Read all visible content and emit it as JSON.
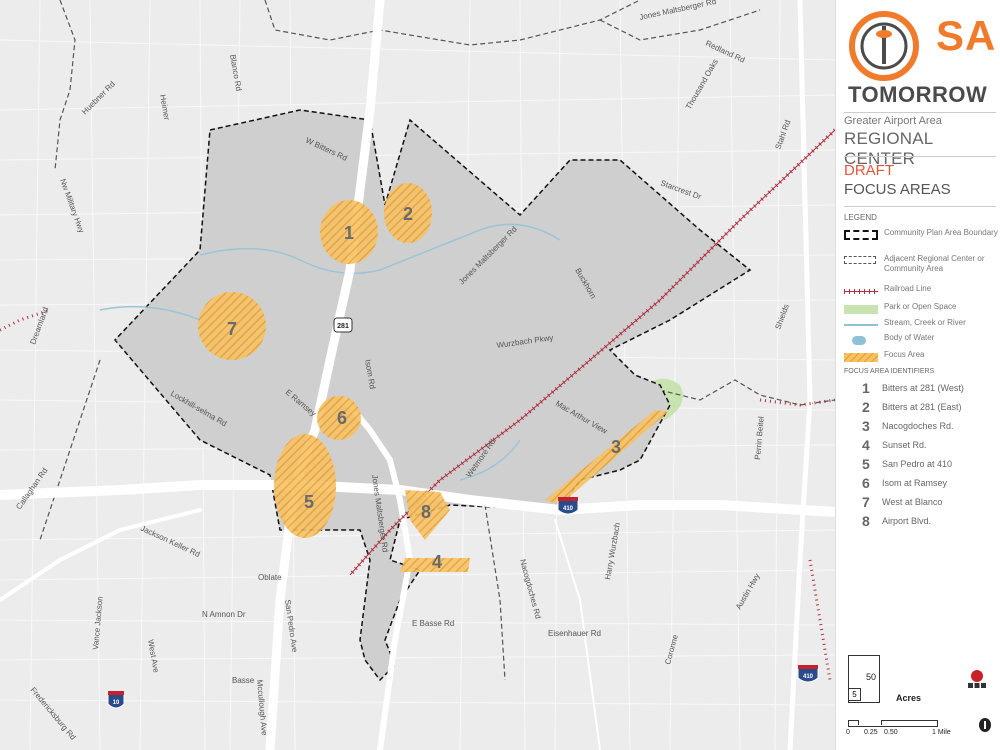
{
  "map": {
    "roads": {
      "jones_maltsberger_top": "Jones Maltsberger Rd",
      "redland": "Redland Rd",
      "blanco": "Blanco Rd",
      "hubner": "Huebner Rd",
      "nw_military": "Nw Military Hwy",
      "bitters": "W Bitters Rd",
      "jones_maltsberger_mid": "Jones Maltsberger Rd",
      "buckhorn": "Buckhorn",
      "wurzbach": "Wurzbach Pkwy",
      "lockhill": "Lockhill-selma Rd",
      "e_ramsey": "E Ramsey",
      "isom": "Isom Rd",
      "mac_arthur": "Mac Arthur View",
      "wetmore": "Wetmore Rd",
      "jones_maltsberger_low": "Jones Maltsberger Rd",
      "nacogdoches": "Nacogdoches Rd",
      "harry_wurzbach": "Harry Wurzbach",
      "e_basse": "E Basse Rd",
      "eisenhauer": "Eisenhauer Rd",
      "n_amnon": "N Amnon Dr",
      "oblate": "Oblate",
      "basse": "Basse",
      "san_pedro": "San Pedro Ave",
      "west_ave": "West Ave",
      "vance_jackson": "Vance Jackson",
      "mccullough": "Mccullough Ave",
      "fredericksburg": "Fredericksburg Rd",
      "callaghan": "Callaghan Rd",
      "jackson_keller": "Jackson Keller Rd",
      "dreamland": "Dreamland",
      "austin_hwy": "Austin Hwy",
      "coronne": "Coronne",
      "perrin": "Perrin Beitel",
      "starcrest": "Starcrest Dr",
      "stahl": "Stahl Rd",
      "thousand_oaks": "Thousand Oaks",
      "shields": "Shields",
      "heimer": "Heimer"
    },
    "shields": {
      "us281": "281",
      "i410": "410",
      "i410_east": "410",
      "i10": "10"
    },
    "focus_labels": [
      "1",
      "2",
      "3",
      "4",
      "5",
      "6",
      "7",
      "8"
    ]
  },
  "panel": {
    "logo": {
      "sa": "SA",
      "tomorrow": "TOMORROW"
    },
    "subtitle_small": "Greater Airport Area",
    "subtitle_large": "REGIONAL CENTER",
    "draft": "DRAFT",
    "focus_title": "FOCUS AREAS",
    "legend_title": "LEGEND",
    "legend": [
      {
        "label": "Community Plan Area Boundary"
      },
      {
        "label": "Adjacent Regional Center or Community Area"
      },
      {
        "label": "Railroad Line"
      },
      {
        "label": "Park or Open Space"
      },
      {
        "label": "Stream, Creek or River"
      },
      {
        "label": "Body of Water"
      },
      {
        "label": "Focus Area"
      }
    ],
    "focus_head": "FOCUS AREA IDENTIFIERS",
    "focus_areas": [
      {
        "num": "1",
        "name": "Bitters at 281 (West)"
      },
      {
        "num": "2",
        "name": "Bitters at 281 (East)"
      },
      {
        "num": "3",
        "name": "Nacogdoches Rd."
      },
      {
        "num": "4",
        "name": "Sunset Rd."
      },
      {
        "num": "5",
        "name": "San Pedro at 410"
      },
      {
        "num": "6",
        "name": "Isom at Ramsey"
      },
      {
        "num": "7",
        "name": "West at Blanco"
      },
      {
        "num": "8",
        "name": "Airport Blvd."
      }
    ],
    "scale": {
      "big": "50",
      "small": "5",
      "unit": "Acres",
      "bar_labels": [
        "0",
        "0.25",
        "0.50",
        "1 Mile"
      ]
    },
    "colors": {
      "orange": "#f07b2c",
      "draft_red": "#e0563b",
      "focus": "#f5b040",
      "park": "#c9e3b0",
      "water": "#8fc0d6",
      "rail": "#b03040"
    }
  }
}
